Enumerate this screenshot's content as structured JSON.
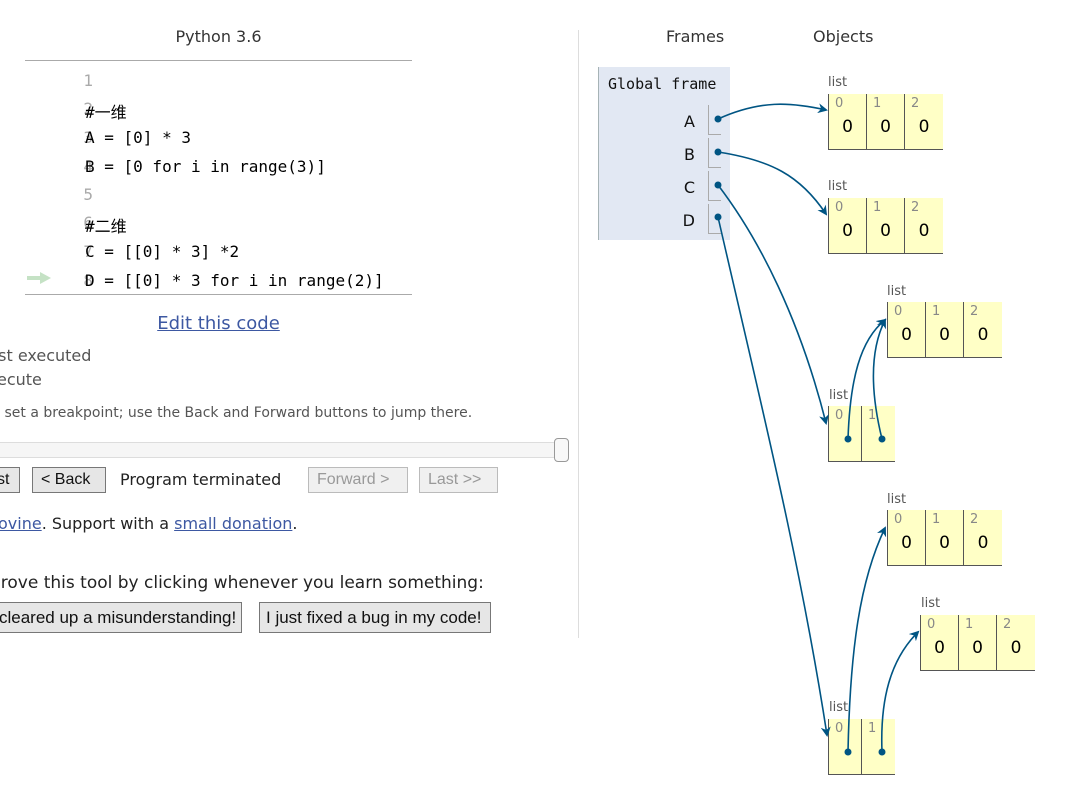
{
  "code_panel": {
    "language": "Python 3.6",
    "lines": [
      {
        "no": "1",
        "code": ""
      },
      {
        "no": "2",
        "code": "#一维"
      },
      {
        "no": "3",
        "code": "A = [0] * 3"
      },
      {
        "no": "4",
        "code": "B = [0 for i in range(3)]"
      },
      {
        "no": "5",
        "code": ""
      },
      {
        "no": "6",
        "code": "#二维"
      },
      {
        "no": "7",
        "code": "C = [[0] * 3] *2"
      },
      {
        "no": "8",
        "code": "D = [[0] * 3 for i in range(2)]"
      }
    ],
    "current_line": "8",
    "edit_link": "Edit this code"
  },
  "legend": {
    "just_executed": "ust executed",
    "next_to_execute": "xecute",
    "breakpoint_hint": "to set a breakpoint; use the Back and Forward buttons to jump there."
  },
  "navigation": {
    "slider_progress": 1.0,
    "first_label": "st",
    "back_label": "< Back",
    "status": "Program terminated",
    "forward_label": "Forward >",
    "last_label": "Last >>"
  },
  "credits": {
    "author_link": "ovine",
    "middle_text": ". Support with a ",
    "donation_link": "small donation",
    "end_text": "."
  },
  "feedback": {
    "prompt": "prove this tool by clicking whenever you learn something:",
    "misunderstanding_button": "cleared up a misunderstanding!",
    "bug_button": "I just fixed a bug in my code!"
  },
  "visualizer": {
    "frames_header": "Frames",
    "objects_header": "Objects",
    "global_frame_title": "Global frame",
    "variables": [
      "A",
      "B",
      "C",
      "D"
    ],
    "heap": {
      "list_label": "list",
      "list_A": {
        "indices": [
          "0",
          "1",
          "2"
        ],
        "values": [
          "0",
          "0",
          "0"
        ]
      },
      "list_B": {
        "indices": [
          "0",
          "1",
          "2"
        ],
        "values": [
          "0",
          "0",
          "0"
        ]
      },
      "list_C_inner": {
        "indices": [
          "0",
          "1",
          "2"
        ],
        "values": [
          "0",
          "0",
          "0"
        ]
      },
      "list_C_outer": {
        "indices": [
          "0",
          "1"
        ]
      },
      "list_D_inner0": {
        "indices": [
          "0",
          "1",
          "2"
        ],
        "values": [
          "0",
          "0",
          "0"
        ]
      },
      "list_D_inner1": {
        "indices": [
          "0",
          "1",
          "2"
        ],
        "values": [
          "0",
          "0",
          "0"
        ]
      },
      "list_D_outer": {
        "indices": [
          "0",
          "1"
        ]
      }
    },
    "arrow_color": "#005583"
  }
}
